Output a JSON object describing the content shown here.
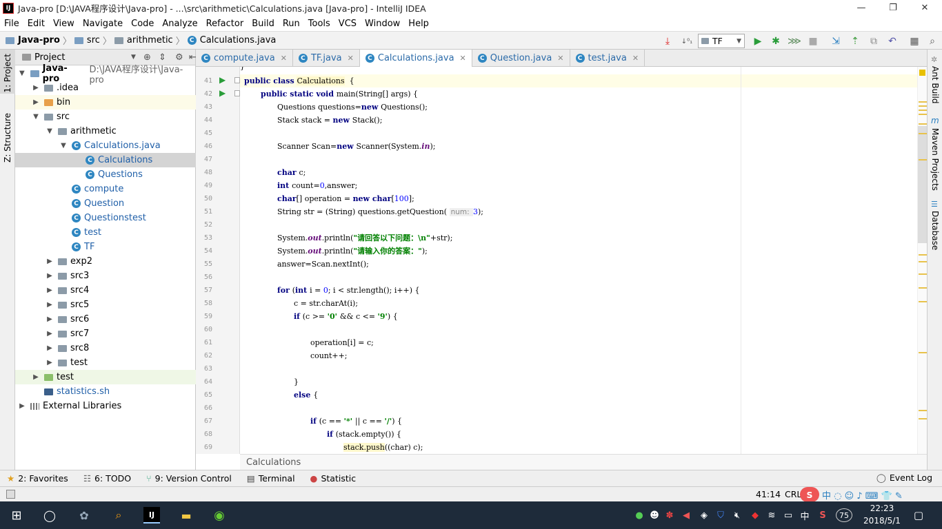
{
  "window": {
    "title": "Java-pro [D:\\JAVA程序设计\\Java-pro] - ...\\src\\arithmetic\\Calculations.java [Java-pro] - IntelliJ IDEA",
    "app_icon": "IJ"
  },
  "menu": [
    "File",
    "Edit",
    "View",
    "Navigate",
    "Code",
    "Analyze",
    "Refactor",
    "Build",
    "Run",
    "Tools",
    "VCS",
    "Window",
    "Help"
  ],
  "breadcrumb": [
    "Java-pro",
    "src",
    "arithmetic",
    "Calculations.java"
  ],
  "toolbar": {
    "run_config": "TF"
  },
  "side_tabs": {
    "left": [
      "1: Project",
      "Z: Structure"
    ],
    "right": [
      "Ant Build",
      "Maven Projects",
      "Database"
    ]
  },
  "project": {
    "header": "Project",
    "tree": [
      {
        "label": "Java-pro",
        "suffix": "D:\\JAVA程序设计\\Java-pro",
        "depth": 0,
        "arrow": "▼",
        "icon": "module",
        "bold": true
      },
      {
        "label": ".idea",
        "depth": 1,
        "arrow": "▶",
        "icon": "folder"
      },
      {
        "label": "bin",
        "depth": 1,
        "arrow": "▶",
        "icon": "folder-orange",
        "tint": "#fdfbe8"
      },
      {
        "label": "src",
        "depth": 1,
        "arrow": "▼",
        "icon": "folder"
      },
      {
        "label": "arithmetic",
        "depth": 2,
        "arrow": "▼",
        "icon": "folder"
      },
      {
        "label": "Calculations.java",
        "depth": 3,
        "arrow": "▼",
        "icon": "class"
      },
      {
        "label": "Calculations",
        "depth": 4,
        "arrow": "",
        "icon": "class",
        "selected": true
      },
      {
        "label": "Questions",
        "depth": 4,
        "arrow": "",
        "icon": "class"
      },
      {
        "label": "compute",
        "depth": 3,
        "arrow": "",
        "icon": "class"
      },
      {
        "label": "Question",
        "depth": 3,
        "arrow": "",
        "icon": "class"
      },
      {
        "label": "Questionstest",
        "depth": 3,
        "arrow": "",
        "icon": "class"
      },
      {
        "label": "test",
        "depth": 3,
        "arrow": "",
        "icon": "class"
      },
      {
        "label": "TF",
        "depth": 3,
        "arrow": "",
        "icon": "class"
      },
      {
        "label": "exp2",
        "depth": 2,
        "arrow": "▶",
        "icon": "folder"
      },
      {
        "label": "src3",
        "depth": 2,
        "arrow": "▶",
        "icon": "folder"
      },
      {
        "label": "src4",
        "depth": 2,
        "arrow": "▶",
        "icon": "folder"
      },
      {
        "label": "src5",
        "depth": 2,
        "arrow": "▶",
        "icon": "folder"
      },
      {
        "label": "src6",
        "depth": 2,
        "arrow": "▶",
        "icon": "folder"
      },
      {
        "label": "src7",
        "depth": 2,
        "arrow": "▶",
        "icon": "folder"
      },
      {
        "label": "src8",
        "depth": 2,
        "arrow": "▶",
        "icon": "folder"
      },
      {
        "label": "test",
        "depth": 2,
        "arrow": "▶",
        "icon": "folder"
      },
      {
        "label": "test",
        "depth": 1,
        "arrow": "▶",
        "icon": "folder-green",
        "tint": "#eff7e6"
      },
      {
        "label": "statistics.sh",
        "depth": 1,
        "arrow": "",
        "icon": "script"
      },
      {
        "label": "External Libraries",
        "depth": 0,
        "arrow": "▶",
        "icon": "libs"
      }
    ]
  },
  "tabs": [
    {
      "label": "compute.java",
      "active": false
    },
    {
      "label": "TF.java",
      "active": false
    },
    {
      "label": "Calculations.java",
      "active": true
    },
    {
      "label": "Question.java",
      "active": false
    },
    {
      "label": "test.java",
      "active": false
    }
  ],
  "editor": {
    "first_line": 41,
    "lines": [
      {
        "n": "41",
        "indent": 0,
        "tokens": [
          [
            "kw",
            "public class "
          ],
          [
            "hl",
            "Calculations"
          ],
          [
            "",
            "  {"
          ]
        ],
        "run": true,
        "highlight": true
      },
      {
        "n": "42",
        "indent": 1,
        "tokens": [
          [
            "kw",
            "public static void "
          ],
          [
            "",
            "main(String[] args) {"
          ]
        ],
        "run": true
      },
      {
        "n": "43",
        "indent": 2,
        "tokens": [
          [
            "",
            "Questions questions="
          ],
          [
            "kw",
            "new "
          ],
          [
            "",
            "Questions();"
          ]
        ]
      },
      {
        "n": "44",
        "indent": 2,
        "tokens": [
          [
            "",
            "Stack stack = "
          ],
          [
            "kw",
            "new "
          ],
          [
            "",
            "Stack();"
          ]
        ]
      },
      {
        "n": "45",
        "indent": 0,
        "tokens": []
      },
      {
        "n": "46",
        "indent": 2,
        "tokens": [
          [
            "",
            "Scanner Scan="
          ],
          [
            "kw",
            "new "
          ],
          [
            "",
            "Scanner(System."
          ],
          [
            "fld",
            "in"
          ],
          [
            "",
            ");"
          ]
        ]
      },
      {
        "n": "47",
        "indent": 0,
        "tokens": []
      },
      {
        "n": "48",
        "indent": 2,
        "tokens": [
          [
            "kw",
            "char "
          ],
          [
            "",
            "c;"
          ]
        ]
      },
      {
        "n": "49",
        "indent": 2,
        "tokens": [
          [
            "kw",
            "int "
          ],
          [
            "",
            "count="
          ],
          [
            "num",
            "0"
          ],
          [
            "",
            ",answer;"
          ]
        ]
      },
      {
        "n": "50",
        "indent": 2,
        "tokens": [
          [
            "kw",
            "char"
          ],
          [
            "",
            "[] operation = "
          ],
          [
            "kw",
            "new char"
          ],
          [
            "",
            "["
          ],
          [
            "num",
            "100"
          ],
          [
            "",
            "];"
          ]
        ]
      },
      {
        "n": "51",
        "indent": 2,
        "tokens": [
          [
            "",
            "String str = (String) questions.getQuestion( "
          ],
          [
            "hint",
            "num: "
          ],
          [
            "num",
            "3"
          ],
          [
            "",
            ");"
          ]
        ]
      },
      {
        "n": "52",
        "indent": 0,
        "tokens": []
      },
      {
        "n": "53",
        "indent": 2,
        "tokens": [
          [
            "",
            "System."
          ],
          [
            "fld",
            "out"
          ],
          [
            "",
            ".println("
          ],
          [
            "str",
            "\"请回答以下问题：\\n\""
          ],
          [
            "",
            "+str);"
          ]
        ]
      },
      {
        "n": "54",
        "indent": 2,
        "tokens": [
          [
            "",
            "System."
          ],
          [
            "fld",
            "out"
          ],
          [
            "",
            ".println("
          ],
          [
            "str",
            "\"请输入你的答案：\""
          ],
          [
            "",
            ");"
          ]
        ]
      },
      {
        "n": "55",
        "indent": 2,
        "tokens": [
          [
            "",
            "answer=Scan.nextInt();"
          ]
        ]
      },
      {
        "n": "56",
        "indent": 0,
        "tokens": []
      },
      {
        "n": "57",
        "indent": 2,
        "tokens": [
          [
            "kw",
            "for "
          ],
          [
            "",
            "("
          ],
          [
            "kw",
            "int "
          ],
          [
            "",
            "i = "
          ],
          [
            "num",
            "0"
          ],
          [
            "",
            "; i < str.length(); i++) {"
          ]
        ]
      },
      {
        "n": "58",
        "indent": 3,
        "tokens": [
          [
            "",
            "c = str.charAt(i);"
          ]
        ]
      },
      {
        "n": "59",
        "indent": 3,
        "tokens": [
          [
            "kw",
            "if "
          ],
          [
            "",
            "(c >= "
          ],
          [
            "str",
            "'0' "
          ],
          [
            "",
            "&& c <= "
          ],
          [
            "str",
            "'9'"
          ],
          [
            "",
            ") {"
          ]
        ]
      },
      {
        "n": "60",
        "indent": 0,
        "tokens": []
      },
      {
        "n": "61",
        "indent": 4,
        "tokens": [
          [
            "",
            "operation[i] = c;"
          ]
        ]
      },
      {
        "n": "62",
        "indent": 4,
        "tokens": [
          [
            "",
            "count++;"
          ]
        ]
      },
      {
        "n": "63",
        "indent": 0,
        "tokens": []
      },
      {
        "n": "64",
        "indent": 3,
        "tokens": [
          [
            "",
            "}"
          ]
        ]
      },
      {
        "n": "65",
        "indent": 3,
        "tokens": [
          [
            "kw",
            "else "
          ],
          [
            "",
            "{"
          ]
        ]
      },
      {
        "n": "66",
        "indent": 0,
        "tokens": []
      },
      {
        "n": "67",
        "indent": 4,
        "tokens": [
          [
            "kw",
            "if "
          ],
          [
            "",
            "(c == "
          ],
          [
            "str",
            "'*' "
          ],
          [
            "",
            "|| c == "
          ],
          [
            "str",
            "'/'"
          ],
          [
            "",
            ") {"
          ]
        ]
      },
      {
        "n": "68",
        "indent": 5,
        "tokens": [
          [
            "kw",
            "if "
          ],
          [
            "",
            "(stack.empty()) {"
          ]
        ]
      },
      {
        "n": "69",
        "indent": 6,
        "tokens": [
          [
            "hl",
            "stack.push"
          ],
          [
            "",
            "((char) c);"
          ]
        ]
      }
    ],
    "footer": "Calculations"
  },
  "tool_windows": [
    {
      "label": "2: Favorites",
      "icon": "star-icon"
    },
    {
      "label": "6: TODO",
      "icon": "todo-icon"
    },
    {
      "label": "9: Version Control",
      "icon": "vcs-icon"
    },
    {
      "label": "Terminal",
      "icon": "terminal-icon"
    },
    {
      "label": "Statistic",
      "icon": "statistic-icon"
    }
  ],
  "event_log": "Event Log",
  "status": {
    "position": "41:14",
    "line_sep": "CRL"
  },
  "taskbar": {
    "time": "22:23",
    "date": "2018/5/1",
    "ime": "中",
    "badge": "75"
  },
  "colors": {
    "accent": "#2e86c1",
    "selection": "#d4d4d4",
    "taskbar": "#1e2b3a"
  }
}
